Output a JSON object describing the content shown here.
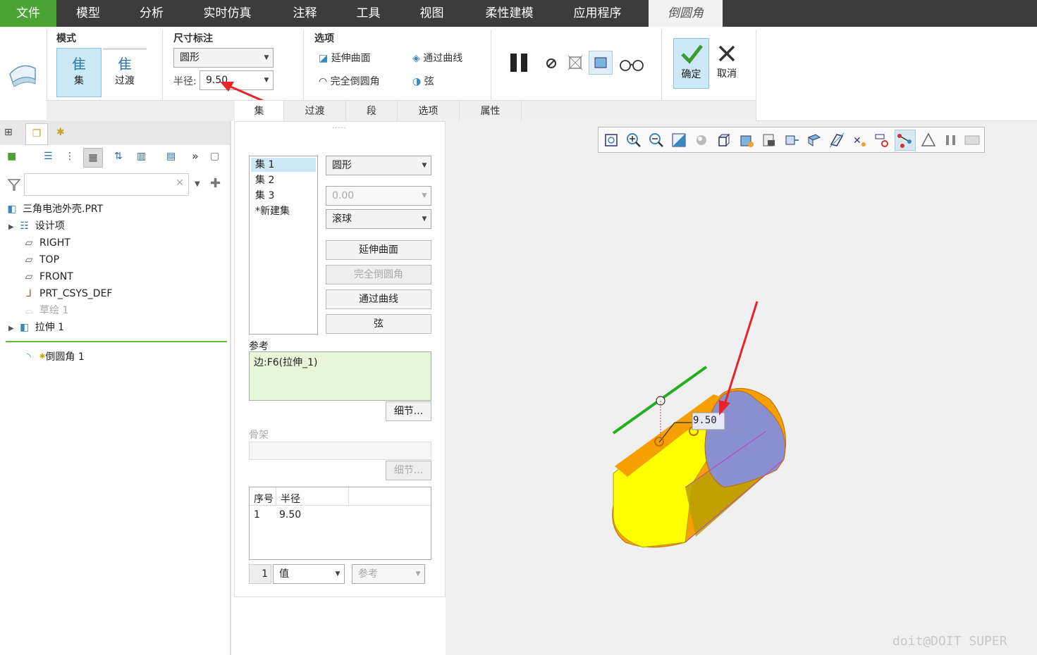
{
  "menu": {
    "items": [
      "文件",
      "模型",
      "分析",
      "实时仿真",
      "注释",
      "工具",
      "视图",
      "柔性建模",
      "应用程序"
    ],
    "active_tab": "倒圆角"
  },
  "ribbon": {
    "mode": {
      "title": "模式",
      "set": "集",
      "transition": "过渡"
    },
    "dimension": {
      "title": "尺寸标注",
      "shape": "圆形",
      "radius_label": "半径:",
      "radius_value": "9.50"
    },
    "options": {
      "title": "选项",
      "extend_surfaces": "延伸曲面",
      "through_curve": "通过曲线",
      "full_round": "完全倒圆角",
      "chord": "弦"
    },
    "confirm": "确定",
    "cancel": "取消"
  },
  "tabs": [
    "集",
    "过渡",
    "段",
    "选项",
    "属性"
  ],
  "tree": {
    "root": "三角电池外壳.PRT",
    "items": [
      {
        "label": "设计项",
        "icon": "design-items-icon",
        "expandable": true
      },
      {
        "label": "RIGHT",
        "icon": "datum-plane-icon"
      },
      {
        "label": "TOP",
        "icon": "datum-plane-icon"
      },
      {
        "label": "FRONT",
        "icon": "datum-plane-icon"
      },
      {
        "label": "PRT_CSYS_DEF",
        "icon": "csys-icon"
      },
      {
        "label": "草绘 1",
        "icon": "sketch-icon"
      },
      {
        "label": "拉伸 1",
        "icon": "extrude-icon",
        "expandable": true
      }
    ],
    "inserted": "倒圆角 1"
  },
  "dialog": {
    "sets": [
      "集 1",
      "集 2",
      "集 3",
      "*新建集"
    ],
    "shape": "圆形",
    "value": "0.00",
    "method": "滚球",
    "btn_extend": "延伸曲面",
    "btn_full_round": "完全倒圆角",
    "btn_through_curve": "通过曲线",
    "btn_chord": "弦",
    "ref_label": "参考",
    "ref_value": "边:F6(拉伸_1)",
    "details": "细节...",
    "skeleton_label": "骨架",
    "table_headers": [
      "序号",
      "半径"
    ],
    "table_rows": [
      [
        "1",
        "9.50"
      ]
    ],
    "bottom_num": "1",
    "bottom_type": "值",
    "bottom_ref": "参考"
  },
  "viewport": {
    "dimension_label": "9.50",
    "watermark": "doit@DOIT SUPER"
  },
  "colors": {
    "accent_green": "#4aa333",
    "menu_bg": "#3c3c3c",
    "model_yellow": "#ffff00",
    "model_orange": "#f5a000",
    "model_blue": "#8a8fd0"
  }
}
